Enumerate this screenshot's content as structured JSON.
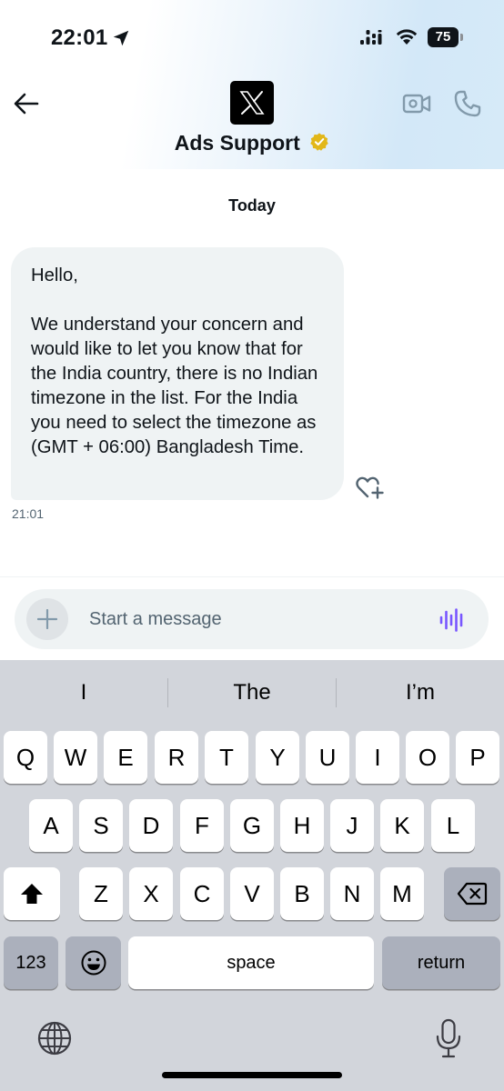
{
  "status_bar": {
    "time": "22:01",
    "battery": "75"
  },
  "header": {
    "title": "Ads Support"
  },
  "conversation": {
    "day_label": "Today",
    "messages": [
      {
        "text": "Hello,\n\nWe understand your concern and would like to let you know that for the India country, there is no Indian timezone in the list. For the India you need to select the timezone as (GMT + 06:00) Bangladesh Time.",
        "time": "21:01"
      }
    ]
  },
  "composer": {
    "placeholder": "Start a message",
    "value": ""
  },
  "keyboard": {
    "suggestions": [
      "I",
      "The",
      "I’m"
    ],
    "row1": [
      "Q",
      "W",
      "E",
      "R",
      "T",
      "Y",
      "U",
      "I",
      "O",
      "P"
    ],
    "row2": [
      "A",
      "S",
      "D",
      "F",
      "G",
      "H",
      "J",
      "K",
      "L"
    ],
    "row3": [
      "Z",
      "X",
      "C",
      "V",
      "B",
      "N",
      "M"
    ],
    "numbers_label": "123",
    "space_label": "space",
    "return_label": "return"
  },
  "colors": {
    "accent_voice": "#7856ff",
    "verified_gold": "#e2b719",
    "bubble_bg": "#eff3f4",
    "keyboard_bg": "#d2d5db"
  },
  "icons": [
    "location-arrow-icon",
    "signal-icon",
    "wifi-icon",
    "battery-icon",
    "back-arrow-icon",
    "x-logo-icon",
    "verified-badge-icon",
    "video-call-icon",
    "phone-icon",
    "add-reaction-icon",
    "plus-icon",
    "voice-wave-icon",
    "shift-icon",
    "backspace-icon",
    "emoji-icon",
    "globe-icon",
    "microphone-icon"
  ]
}
